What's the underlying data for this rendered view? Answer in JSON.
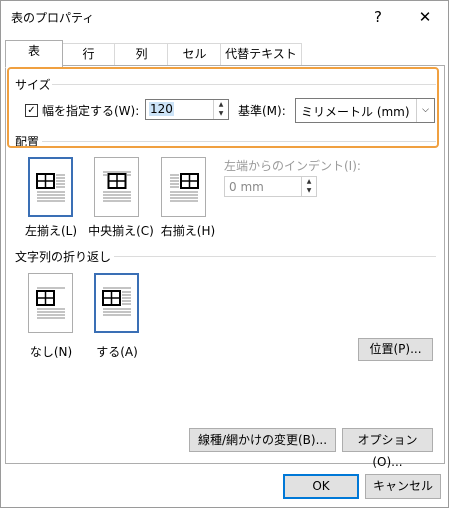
{
  "window": {
    "title": "表のプロパティ",
    "help": "?",
    "close": "✕"
  },
  "tabs": [
    "表",
    "行",
    "列",
    "セル",
    "代替テキスト"
  ],
  "size": {
    "section_label": "サイズ",
    "checkbox_checked": true,
    "checkbox_mark": "✓",
    "width_label": "幅を指定する(W):",
    "width_value": "120",
    "basis_label": "基準(M):",
    "basis_value": "ミリメートル (mm)"
  },
  "alignment": {
    "section_label": "配置",
    "options": [
      "左揃え(L)",
      "中央揃え(C)",
      "右揃え(H)"
    ],
    "selected": "左揃え(L)",
    "indent_label": "左端からのインデント(I):",
    "indent_value": "0 mm"
  },
  "wrap": {
    "section_label": "文字列の折り返し",
    "options": [
      "なし(N)",
      "する(A)"
    ],
    "selected": "する(A)",
    "position_button": "位置(P)..."
  },
  "footer": {
    "borders_button": "線種/網かけの変更(B)...",
    "options_button": "オプション(O)...",
    "ok": "OK",
    "cancel": "キャンセル"
  }
}
